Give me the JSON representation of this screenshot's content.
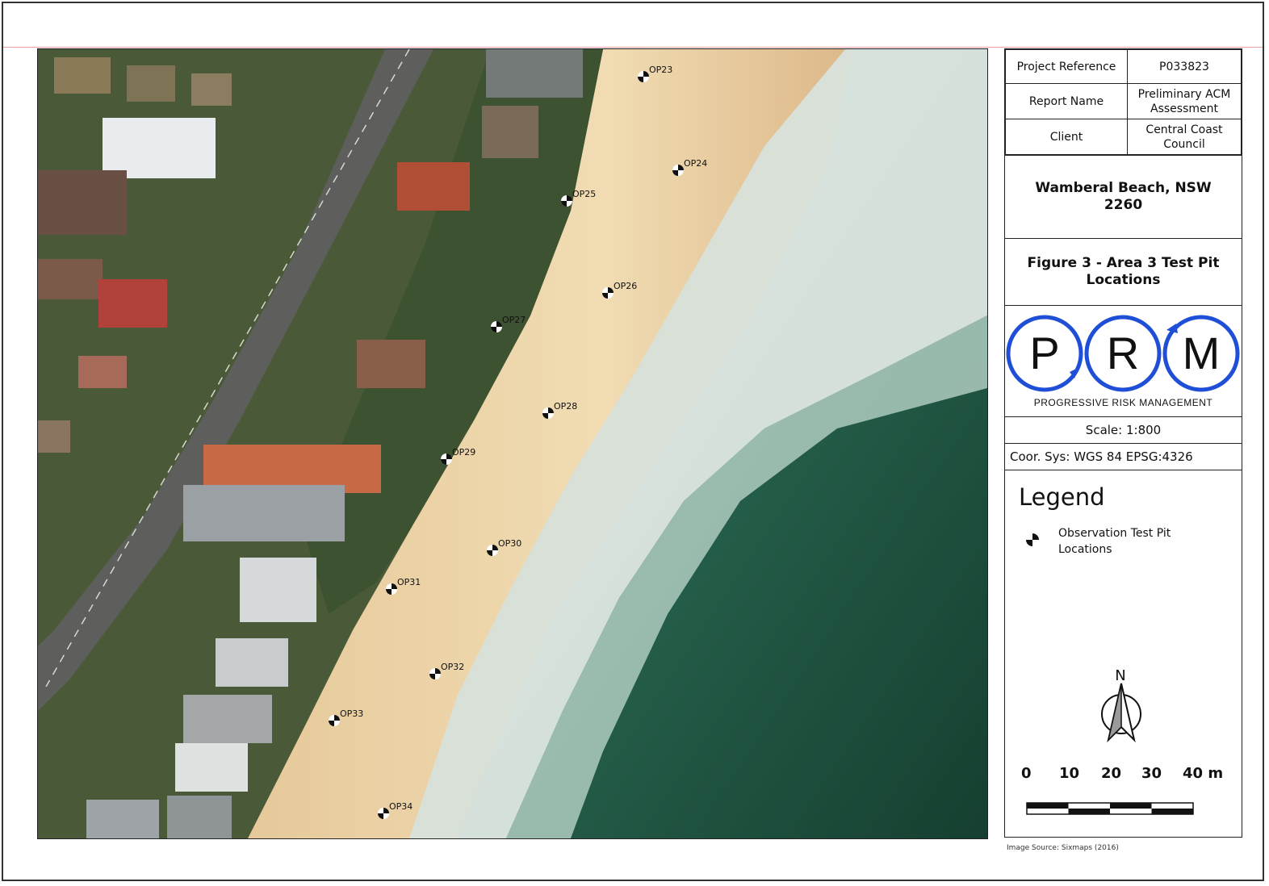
{
  "info": {
    "project_reference_label": "Project Reference",
    "project_reference_value": "P033823",
    "report_name_label": "Report Name",
    "report_name_value_line1": "Preliminary ACM",
    "report_name_value_line2": "Assessment",
    "client_label": "Client",
    "client_value_line1": "Central Coast",
    "client_value_line2": "Council"
  },
  "location_line1": "Wamberal Beach, NSW",
  "location_line2": "2260",
  "figure_title_line1": "Figure 3 - Area 3 Test Pit",
  "figure_title_line2": "Locations",
  "logo": {
    "letters": [
      "P",
      "R",
      "M"
    ],
    "tagline": "PROGRESSIVE RISK MANAGEMENT",
    "ring_color": "#1f4fd6"
  },
  "scale_text": "Scale: 1:800",
  "coord_sys_text": "Coor. Sys: WGS 84 EPSG:4326",
  "legend": {
    "title": "Legend",
    "item_line1": "Observation Test Pit",
    "item_line2": "Locations"
  },
  "north_label": "N",
  "scalebar": {
    "labels": [
      "0",
      "10",
      "20",
      "30",
      "40 m"
    ]
  },
  "image_source": "Image Source: Sixmaps (2016)",
  "test_pits": [
    "OP23",
    "OP24",
    "OP25",
    "OP26",
    "OP27",
    "OP28",
    "OP29",
    "OP30",
    "OP31",
    "OP32",
    "OP33",
    "OP34"
  ],
  "map_colors": {
    "ocean": "#1e5a45",
    "surf": "#e8ece8",
    "sand": "#ecd4a6",
    "vegetation": "#3c4f2c",
    "road": "#5e5e5c"
  }
}
